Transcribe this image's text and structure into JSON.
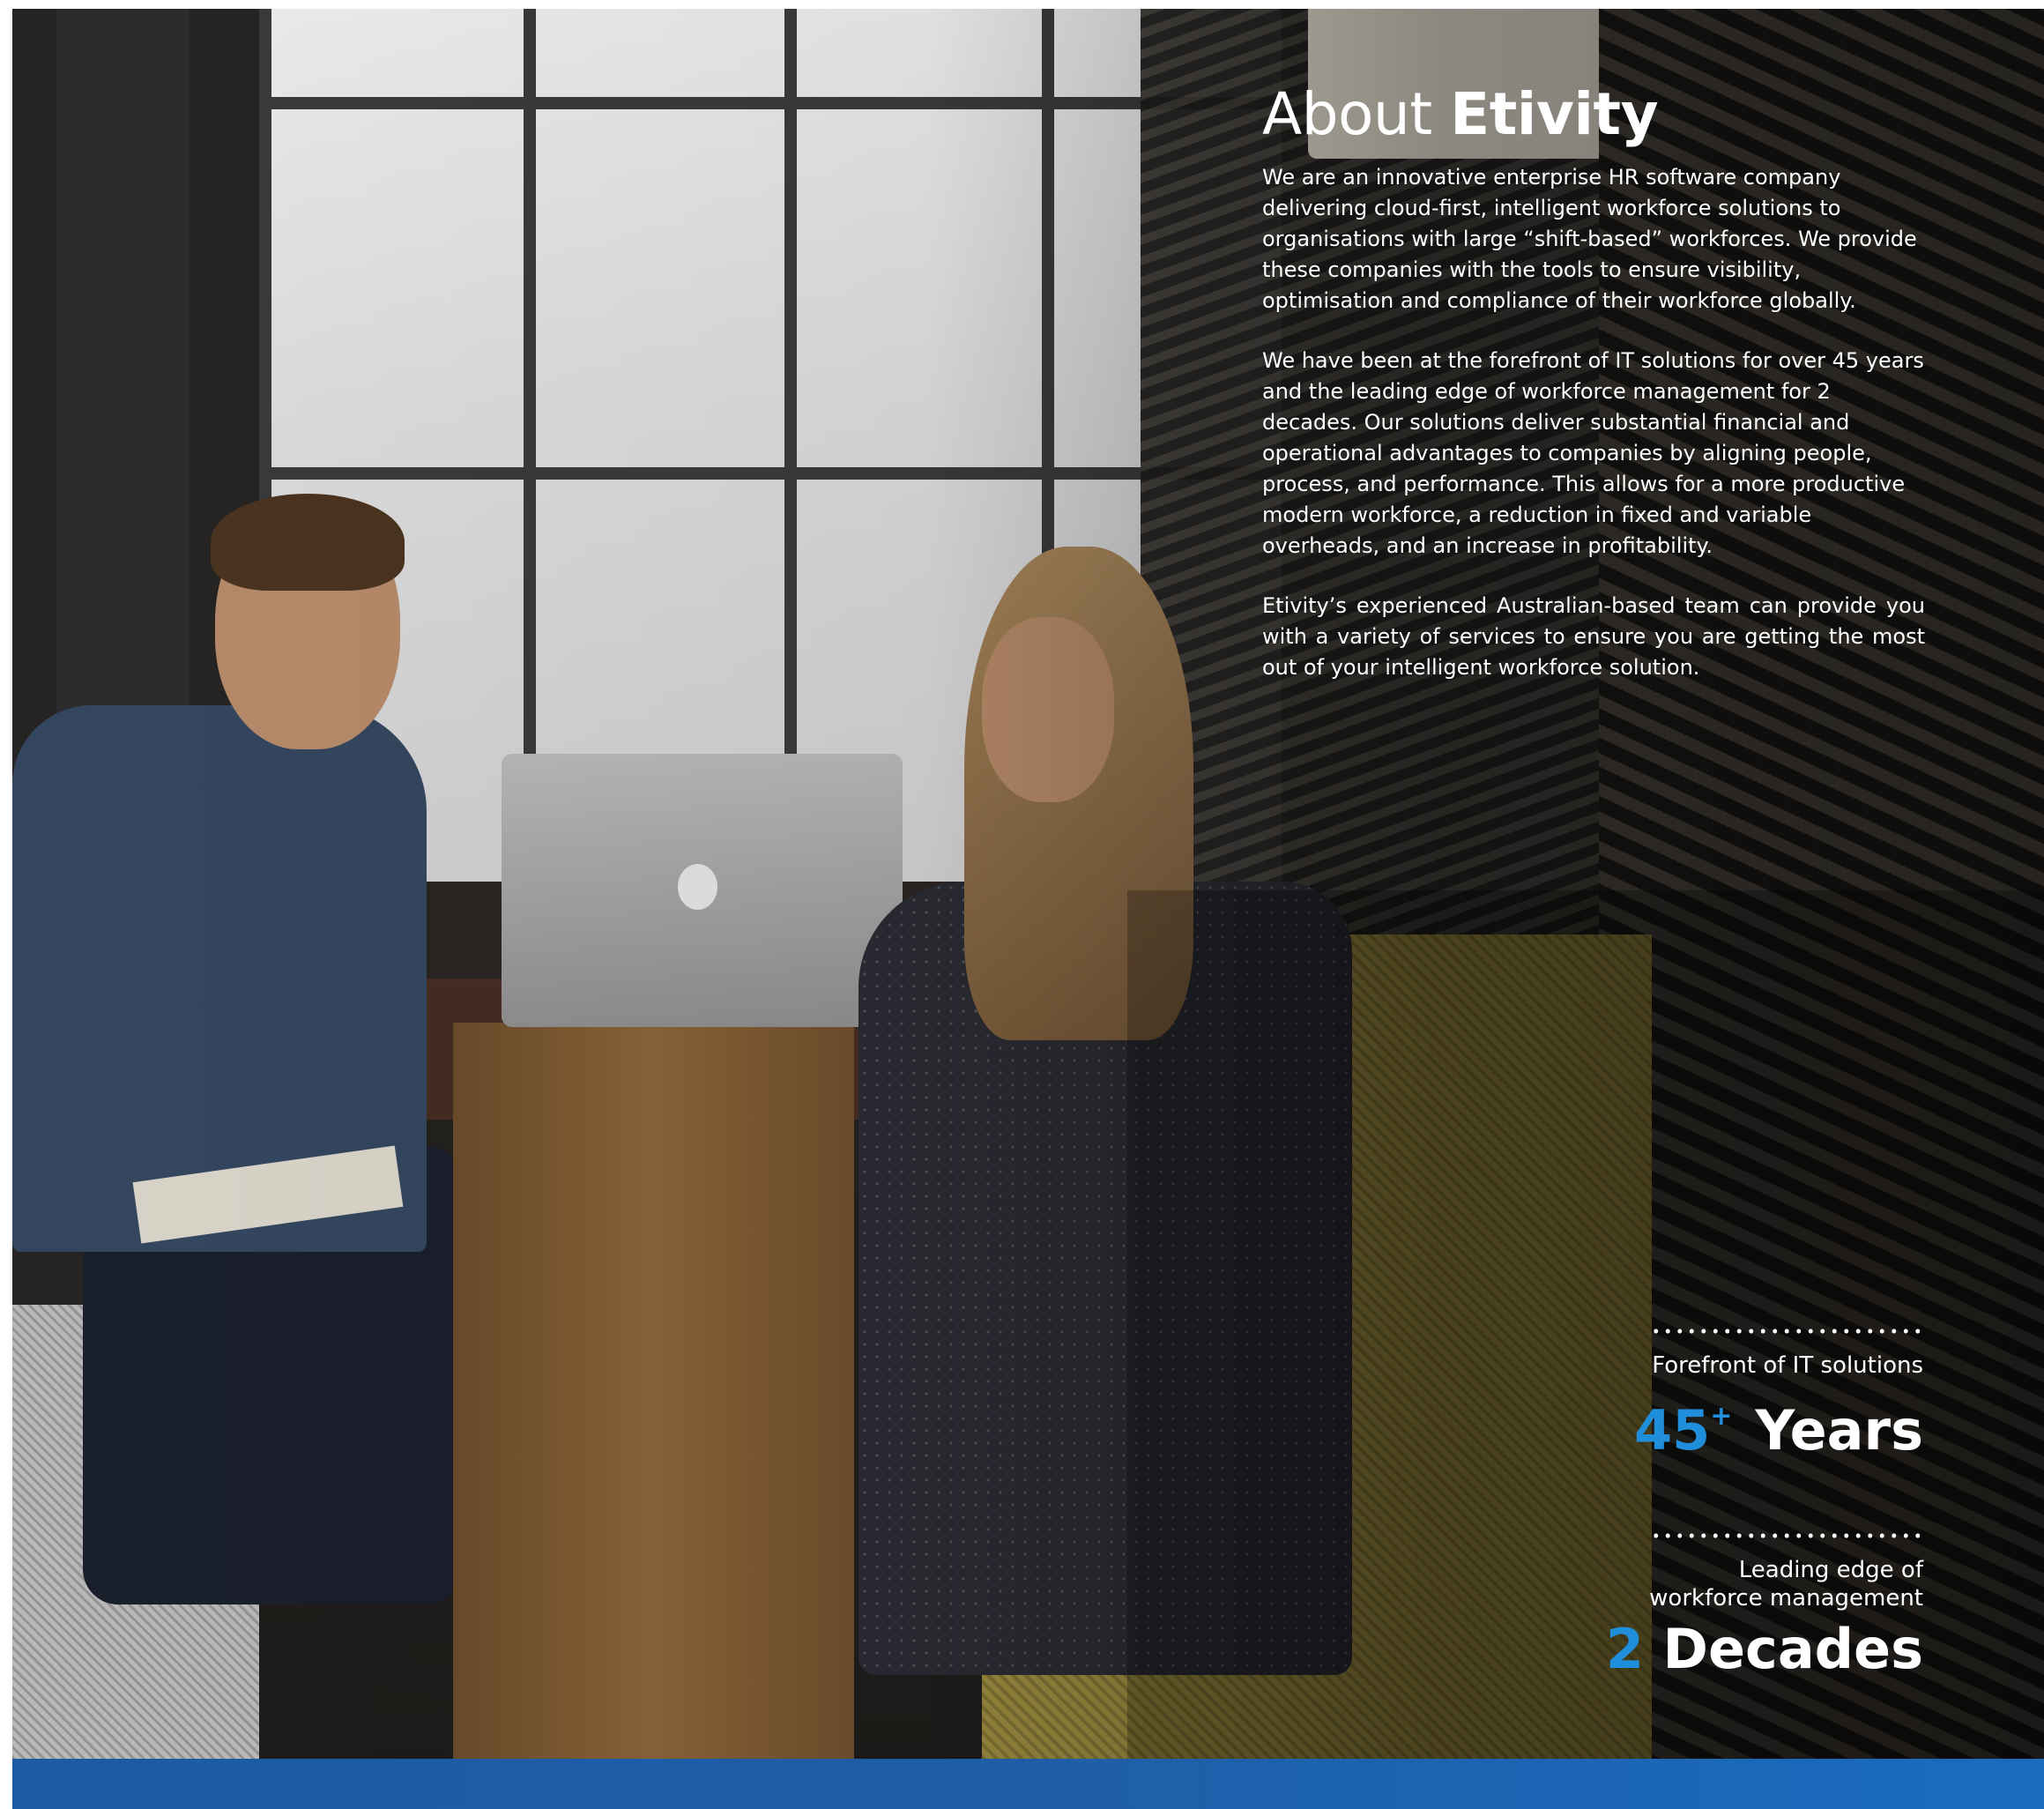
{
  "about": {
    "title_prefix": "About",
    "title_brand": "Etivity",
    "paragraphs": [
      "We are an innovative enterprise HR software company delivering cloud-first, intelligent workforce solutions to organisations with large “shift-based” workforces. We provide these companies with the tools to ensure visibility, optimisation and compliance of their workforce globally.",
      "We have been at the forefront of IT solutions for over 45 years and the leading edge of workforce management for 2 decades. Our solutions deliver substantial financial and operational advantages to companies by aligning people, process, and performance. This allows for a more productive modern workforce, a reduction in fixed and variable overheads, and an increase in profitability.",
      "Etivity’s experienced Australian-based team can provide you with a variety of services to ensure you are getting the most out of your intelligent workforce solution."
    ]
  },
  "stats": [
    {
      "label": "Forefront of IT solutions",
      "number": "45",
      "suffix": "+",
      "unit": "Years"
    },
    {
      "label_line1": "Leading edge of",
      "label_line2": "workforce management",
      "number": "2",
      "unit": "Decades"
    }
  ],
  "colors": {
    "accent": "#1f8fdc",
    "footer_bar": "#1c5aa5",
    "text": "#ffffff"
  },
  "photo": "office-meeting-photo"
}
